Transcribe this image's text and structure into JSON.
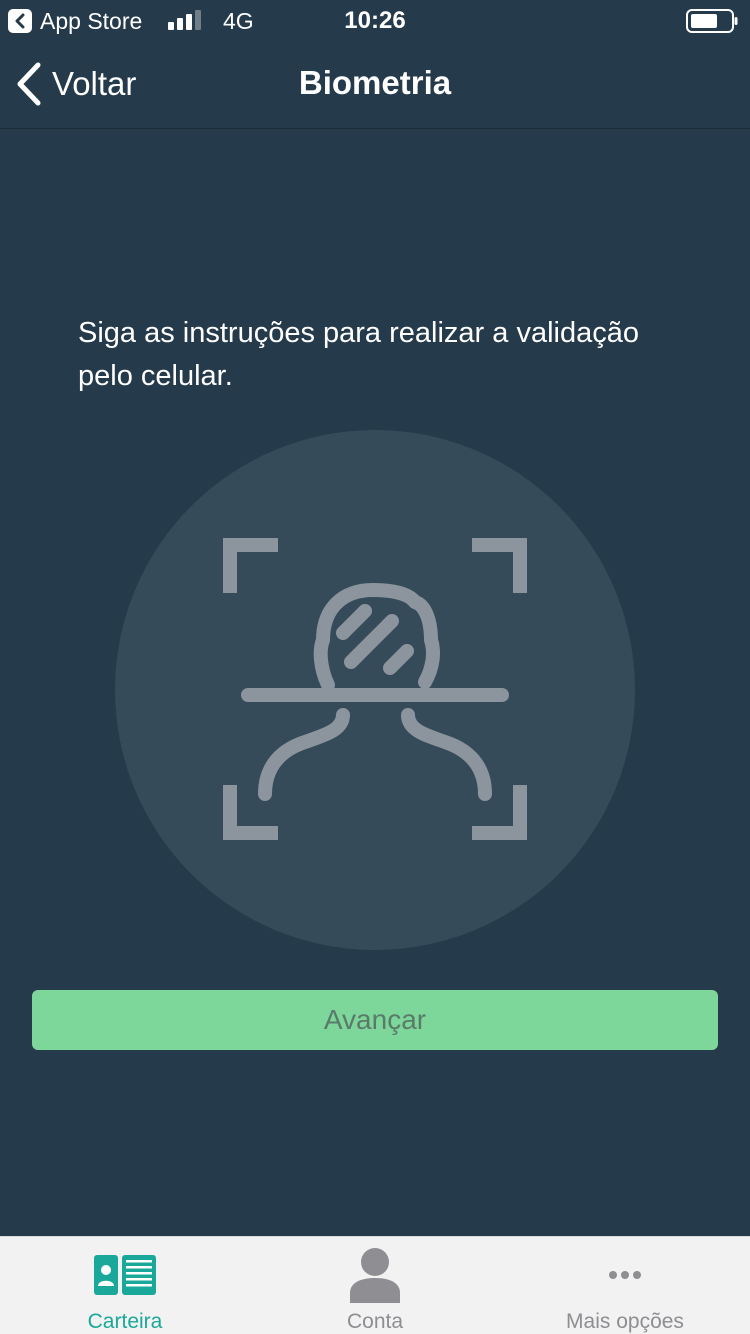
{
  "status_bar": {
    "app_label": "App Store",
    "network": "4G",
    "time": "10:26"
  },
  "nav": {
    "back_label": "Voltar",
    "title": "Biometria"
  },
  "content": {
    "instruction": "Siga as instruções para realizar a validação pelo celular.",
    "illustration_icon": "face-scan-icon",
    "advance_label": "Avançar",
    "advance_enabled": false
  },
  "tab_bar": {
    "tabs": [
      {
        "label": "Carteira",
        "icon": "wallet-card-icon",
        "active": true
      },
      {
        "label": "Conta",
        "icon": "person-icon",
        "active": false
      },
      {
        "label": "Mais opções",
        "icon": "more-dots-icon",
        "active": false
      }
    ]
  },
  "colors": {
    "background": "#253a4a",
    "circle": "#354b5a",
    "illustration": "#8c959d",
    "button": "#7dd79a",
    "button_text": "#5a7b6a",
    "tab_active": "#1aa89a",
    "tab_inactive": "#8e8e93"
  }
}
